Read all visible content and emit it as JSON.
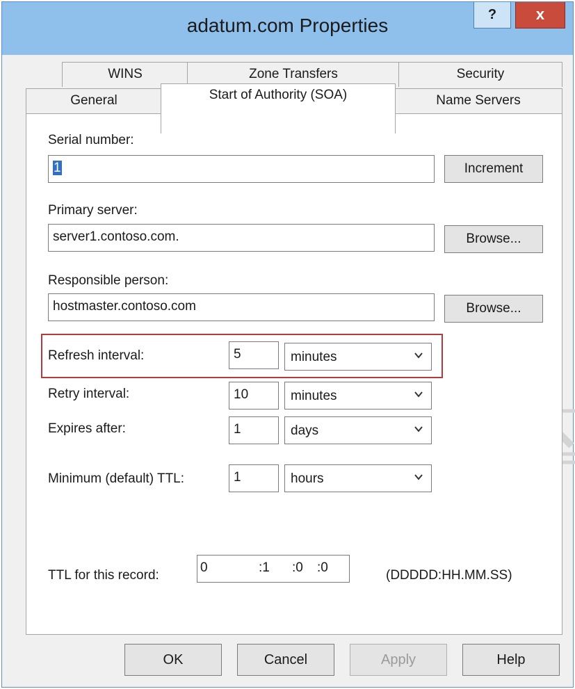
{
  "window": {
    "title": "adatum.com Properties",
    "help_label": "?",
    "close_label": "x"
  },
  "tabs": {
    "row1": [
      "WINS",
      "Zone Transfers",
      "Security"
    ],
    "row2": [
      "General",
      "Start of Authority (SOA)",
      "Name Servers"
    ],
    "active": "Start of Authority (SOA)"
  },
  "soa": {
    "serial": {
      "label": "Serial number:",
      "value": "1",
      "button": "Increment"
    },
    "primary": {
      "label": "Primary server:",
      "value": "server1.contoso.com.",
      "button": "Browse..."
    },
    "responsible": {
      "label": "Responsible person:",
      "value": "hostmaster.contoso.com",
      "button": "Browse..."
    },
    "intervals": [
      {
        "label": "Refresh interval:",
        "value": "5",
        "unit": "minutes"
      },
      {
        "label": "Retry interval:",
        "value": "10",
        "unit": "minutes"
      },
      {
        "label": "Expires after:",
        "value": "1",
        "unit": "days"
      },
      {
        "label": "Minimum (default) TTL:",
        "value": "1",
        "unit": "hours"
      }
    ],
    "ttl": {
      "label": "TTL for this record:",
      "days": "0",
      "hours": ":1",
      "minutes": ":0",
      "seconds": ":0",
      "format": "(DDDDD:HH.MM.SS)"
    }
  },
  "buttons": {
    "ok": "OK",
    "cancel": "Cancel",
    "apply": "Apply",
    "help": "Help"
  },
  "colors": {
    "titlebar": "#8fc0ec",
    "close": "#c84b3b",
    "highlight": "#b23a3a",
    "selection": "#3370c4"
  }
}
